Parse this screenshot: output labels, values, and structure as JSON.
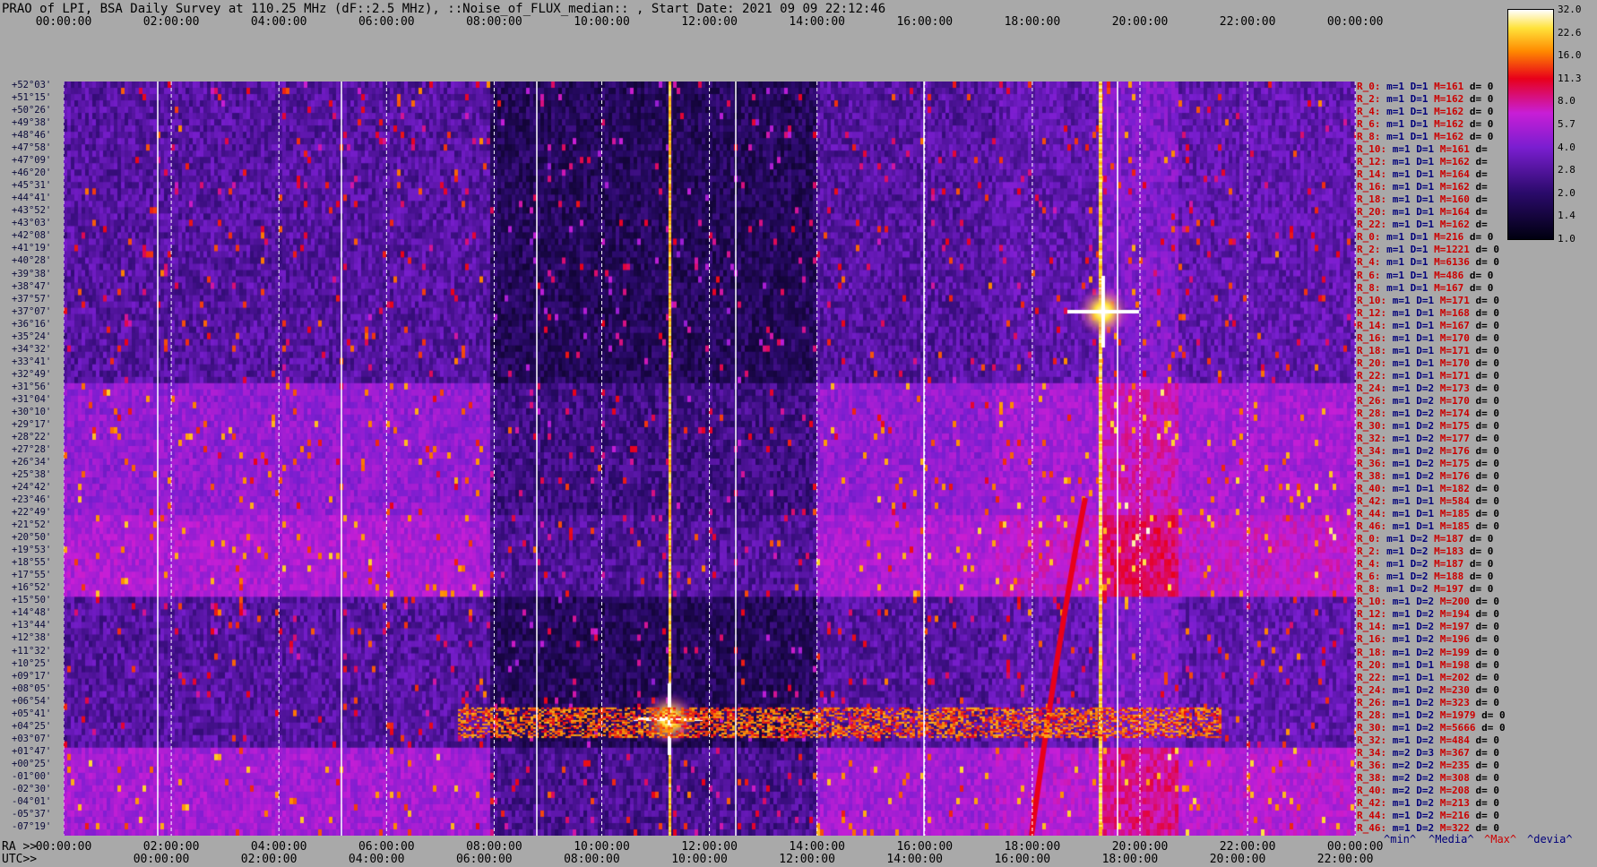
{
  "title": "PRAO of LPI, BSA Daily Survey at 110.25 MHz (dF::2.5 MHz), ::Noise_of_FLUX_median:: , Start Date: 2021 09 09 22:12:46",
  "chart_data": {
    "type": "heatmap",
    "title": "PRAO of LPI, BSA Daily Survey at 110.25 MHz (dF::2.5 MHz), ::Noise_of_FLUX_median:: , Start Date: 2021 09 09 22:12:46",
    "x_top_ticks": [
      "00:00:00",
      "02:00:00",
      "04:00:00",
      "06:00:00",
      "08:00:00",
      "10:00:00",
      "12:00:00",
      "14:00:00",
      "16:00:00",
      "18:00:00",
      "20:00:00",
      "22:00:00",
      "00:00:00"
    ],
    "x_bottom_ra_label": "RA >>",
    "x_bottom_ra_ticks": [
      "00:00:00",
      "02:00:00",
      "04:00:00",
      "06:00:00",
      "08:00:00",
      "10:00:00",
      "12:00:00",
      "14:00:00",
      "16:00:00",
      "18:00:00",
      "20:00:00",
      "22:00:00",
      "00:00:00"
    ],
    "x_bottom_utc_label": "UTC>>",
    "x_bottom_utc_ticks": [
      "00:00:00",
      "02:00:00",
      "04:00:00",
      "06:00:00",
      "08:00:00",
      "10:00:00",
      "12:00:00",
      "14:00:00",
      "16:00:00",
      "18:00:00",
      "20:00:00",
      "22:00:00"
    ],
    "dec_labels": [
      "+52°03'",
      "+51°15'",
      "+50°26'",
      "+49°38'",
      "+48°46'",
      "+47°58'",
      "+47°09'",
      "+46°20'",
      "+45°31'",
      "+44°41'",
      "+43°52'",
      "+43°03'",
      "+42°08'",
      "+41°19'",
      "+40°28'",
      "+39°38'",
      "+38°47'",
      "+37°57'",
      "+37°07'",
      "+36°16'",
      "+35°24'",
      "+34°32'",
      "+33°41'",
      "+32°49'",
      "+31°56'",
      "+31°04'",
      "+30°10'",
      "+29°17'",
      "+28°22'",
      "+27°28'",
      "+26°34'",
      "+25°38'",
      "+24°42'",
      "+23°46'",
      "+22°49'",
      "+21°52'",
      "+20°50'",
      "+19°53'",
      "+18°55'",
      "+17°55'",
      "+16°52'",
      "+15°50'",
      "+14°48'",
      "+13°44'",
      "+12°38'",
      "+11°32'",
      "+10°25'",
      "+09°17'",
      "+08°05'",
      "+06°54'",
      "+05°41'",
      "+04°25'",
      "+03°07'",
      "+01°47'",
      "+00°25'",
      "-01°00'",
      "-02°30'",
      "-04°01'",
      "-05°37'",
      "-07°19'"
    ],
    "rows": [
      {
        "r": "R_0:",
        "m": "m=1",
        "d": "D=1",
        "mx": "M=161",
        "dev": "d= 0"
      },
      {
        "r": "R_2:",
        "m": "m=1",
        "d": "D=1",
        "mx": "M=162",
        "dev": "d= 0"
      },
      {
        "r": "R_4:",
        "m": "m=1",
        "d": "D=1",
        "mx": "M=162",
        "dev": "d= 0"
      },
      {
        "r": "R_6:",
        "m": "m=1",
        "d": "D=1",
        "mx": "M=162",
        "dev": "d= 0"
      },
      {
        "r": "R_8:",
        "m": "m=1",
        "d": "D=1",
        "mx": "M=162",
        "dev": "d= 0"
      },
      {
        "r": "R_10:",
        "m": "m=1",
        "d": "D=1",
        "mx": "M=161",
        "dev": "d="
      },
      {
        "r": "R_12:",
        "m": "m=1",
        "d": "D=1",
        "mx": "M=162",
        "dev": "d="
      },
      {
        "r": "R_14:",
        "m": "m=1",
        "d": "D=1",
        "mx": "M=164",
        "dev": "d="
      },
      {
        "r": "R_16:",
        "m": "m=1",
        "d": "D=1",
        "mx": "M=162",
        "dev": "d="
      },
      {
        "r": "R_18:",
        "m": "m=1",
        "d": "D=1",
        "mx": "M=160",
        "dev": "d="
      },
      {
        "r": "R_20:",
        "m": "m=1",
        "d": "D=1",
        "mx": "M=164",
        "dev": "d="
      },
      {
        "r": "R_22:",
        "m": "m=1",
        "d": "D=1",
        "mx": "M=162",
        "dev": "d="
      },
      {
        "r": "R_0:",
        "m": "m=1",
        "d": "D=1",
        "mx": "M=216",
        "dev": "d= 0"
      },
      {
        "r": "R_2:",
        "m": "m=1",
        "d": "D=1",
        "mx": "M=1221",
        "dev": "d= 0"
      },
      {
        "r": "R_4:",
        "m": "m=1",
        "d": "D=1",
        "mx": "M=6136",
        "dev": "d= 0"
      },
      {
        "r": "R_6:",
        "m": "m=1",
        "d": "D=1",
        "mx": "M=486",
        "dev": "d= 0"
      },
      {
        "r": "R_8:",
        "m": "m=1",
        "d": "D=1",
        "mx": "M=167",
        "dev": "d= 0"
      },
      {
        "r": "R_10:",
        "m": "m=1",
        "d": "D=1",
        "mx": "M=171",
        "dev": "d= 0"
      },
      {
        "r": "R_12:",
        "m": "m=1",
        "d": "D=1",
        "mx": "M=168",
        "dev": "d= 0"
      },
      {
        "r": "R_14:",
        "m": "m=1",
        "d": "D=1",
        "mx": "M=167",
        "dev": "d= 0"
      },
      {
        "r": "R_16:",
        "m": "m=1",
        "d": "D=1",
        "mx": "M=170",
        "dev": "d= 0"
      },
      {
        "r": "R_18:",
        "m": "m=1",
        "d": "D=1",
        "mx": "M=171",
        "dev": "d= 0"
      },
      {
        "r": "R_20:",
        "m": "m=1",
        "d": "D=1",
        "mx": "M=170",
        "dev": "d= 0"
      },
      {
        "r": "R_22:",
        "m": "m=1",
        "d": "D=1",
        "mx": "M=171",
        "dev": "d= 0"
      },
      {
        "r": "R_24:",
        "m": "m=1",
        "d": "D=2",
        "mx": "M=173",
        "dev": "d= 0"
      },
      {
        "r": "R_26:",
        "m": "m=1",
        "d": "D=2",
        "mx": "M=170",
        "dev": "d= 0"
      },
      {
        "r": "R_28:",
        "m": "m=1",
        "d": "D=2",
        "mx": "M=174",
        "dev": "d= 0"
      },
      {
        "r": "R_30:",
        "m": "m=1",
        "d": "D=2",
        "mx": "M=175",
        "dev": "d= 0"
      },
      {
        "r": "R_32:",
        "m": "m=1",
        "d": "D=2",
        "mx": "M=177",
        "dev": "d= 0"
      },
      {
        "r": "R_34:",
        "m": "m=1",
        "d": "D=2",
        "mx": "M=176",
        "dev": "d= 0"
      },
      {
        "r": "R_36:",
        "m": "m=1",
        "d": "D=2",
        "mx": "M=175",
        "dev": "d= 0"
      },
      {
        "r": "R_38:",
        "m": "m=1",
        "d": "D=2",
        "mx": "M=176",
        "dev": "d= 0"
      },
      {
        "r": "R_40:",
        "m": "m=1",
        "d": "D=1",
        "mx": "M=182",
        "dev": "d= 0"
      },
      {
        "r": "R_42:",
        "m": "m=1",
        "d": "D=1",
        "mx": "M=584",
        "dev": "d= 0"
      },
      {
        "r": "R_44:",
        "m": "m=1",
        "d": "D=1",
        "mx": "M=185",
        "dev": "d= 0"
      },
      {
        "r": "R_46:",
        "m": "m=1",
        "d": "D=1",
        "mx": "M=185",
        "dev": "d= 0"
      },
      {
        "r": "R_0:",
        "m": "m=1",
        "d": "D=2",
        "mx": "M=187",
        "dev": "d= 0"
      },
      {
        "r": "R_2:",
        "m": "m=1",
        "d": "D=2",
        "mx": "M=183",
        "dev": "d= 0"
      },
      {
        "r": "R_4:",
        "m": "m=1",
        "d": "D=2",
        "mx": "M=187",
        "dev": "d= 0"
      },
      {
        "r": "R_6:",
        "m": "m=1",
        "d": "D=2",
        "mx": "M=188",
        "dev": "d= 0"
      },
      {
        "r": "R_8:",
        "m": "m=1",
        "d": "D=2",
        "mx": "M=197",
        "dev": "d= 0"
      },
      {
        "r": "R_10:",
        "m": "m=1",
        "d": "D=2",
        "mx": "M=200",
        "dev": "d= 0"
      },
      {
        "r": "R_12:",
        "m": "m=1",
        "d": "D=2",
        "mx": "M=194",
        "dev": "d= 0"
      },
      {
        "r": "R_14:",
        "m": "m=1",
        "d": "D=2",
        "mx": "M=197",
        "dev": "d= 0"
      },
      {
        "r": "R_16:",
        "m": "m=1",
        "d": "D=2",
        "mx": "M=196",
        "dev": "d= 0"
      },
      {
        "r": "R_18:",
        "m": "m=1",
        "d": "D=2",
        "mx": "M=199",
        "dev": "d= 0"
      },
      {
        "r": "R_20:",
        "m": "m=1",
        "d": "D=1",
        "mx": "M=198",
        "dev": "d= 0"
      },
      {
        "r": "R_22:",
        "m": "m=1",
        "d": "D=1",
        "mx": "M=202",
        "dev": "d= 0"
      },
      {
        "r": "R_24:",
        "m": "m=1",
        "d": "D=2",
        "mx": "M=230",
        "dev": "d= 0"
      },
      {
        "r": "R_26:",
        "m": "m=1",
        "d": "D=2",
        "mx": "M=323",
        "dev": "d= 0"
      },
      {
        "r": "R_28:",
        "m": "m=1",
        "d": "D=2",
        "mx": "M=1979",
        "dev": "d= 0"
      },
      {
        "r": "R_30:",
        "m": "m=1",
        "d": "D=2",
        "mx": "M=5666",
        "dev": "d= 0"
      },
      {
        "r": "R_32:",
        "m": "m=1",
        "d": "D=2",
        "mx": "M=484",
        "dev": "d= 0"
      },
      {
        "r": "R_34:",
        "m": "m=2",
        "d": "D=3",
        "mx": "M=367",
        "dev": "d= 0"
      },
      {
        "r": "R_36:",
        "m": "m=2",
        "d": "D=2",
        "mx": "M=235",
        "dev": "d= 0"
      },
      {
        "r": "R_38:",
        "m": "m=2",
        "d": "D=2",
        "mx": "M=308",
        "dev": "d= 0"
      },
      {
        "r": "R_40:",
        "m": "m=2",
        "d": "D=2",
        "mx": "M=208",
        "dev": "d= 0"
      },
      {
        "r": "R_42:",
        "m": "m=1",
        "d": "D=2",
        "mx": "M=213",
        "dev": "d= 0"
      },
      {
        "r": "R_44:",
        "m": "m=1",
        "d": "D=2",
        "mx": "M=216",
        "dev": "d= 0"
      },
      {
        "r": "R_46:",
        "m": "m=1",
        "d": "D=2",
        "mx": "M=322",
        "dev": "d= 0"
      }
    ],
    "colorbar_ticks": [
      "32.0",
      "22.6",
      "16.0",
      "11.3",
      "8.0",
      "5.7",
      "4.0",
      "2.8",
      "2.0",
      "1.4",
      "1.0"
    ],
    "colorbar_range": [
      1.0,
      32.0
    ],
    "colormap": [
      "#000010",
      "#2a0a6a",
      "#7a1ed0",
      "#c81ed6",
      "#e8001a",
      "#ff8a00",
      "#ffe23a",
      "#ffffff"
    ],
    "legend": {
      "min": "^min^",
      "median": "^Media^",
      "max": "^Max^",
      "dev": "^devia^"
    },
    "legend_colors": {
      "min": "#00007a",
      "median": "#00007a",
      "max": "#cc0000",
      "dev": "#00007a"
    },
    "background": "#a9a9a9"
  }
}
